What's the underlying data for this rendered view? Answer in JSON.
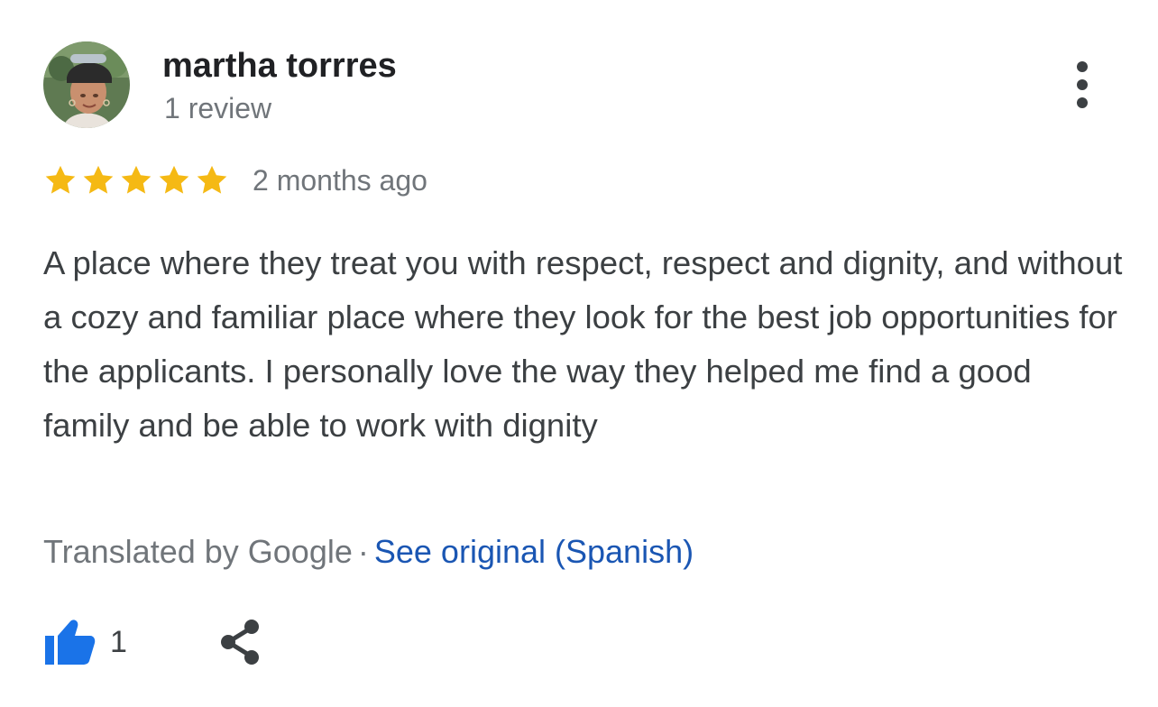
{
  "review": {
    "author_name": "martha torrres",
    "author_review_count": "1 review",
    "rating": 5,
    "rating_max": 5,
    "date": "2 months ago",
    "text": "A place where they treat you with respect, respect and dignity, and without a cozy and familiar place where they look for the best job opportunities for the applicants. I personally love the way they helped me find a good family and be able to work with dignity",
    "translated_by": "Translated by Google",
    "separator": "·",
    "see_original": "See original (Spanish)",
    "like_count": "1"
  },
  "colors": {
    "star": "#f5b914",
    "link": "#1a56b3",
    "like_icon": "#1a73e8",
    "secondary_text": "#70757a",
    "body_text": "#3c4043"
  },
  "icons": {
    "avatar": "avatar-photo",
    "more": "more-vert-icon",
    "star": "star-icon",
    "like": "thumbs-up-icon",
    "share": "share-icon"
  }
}
